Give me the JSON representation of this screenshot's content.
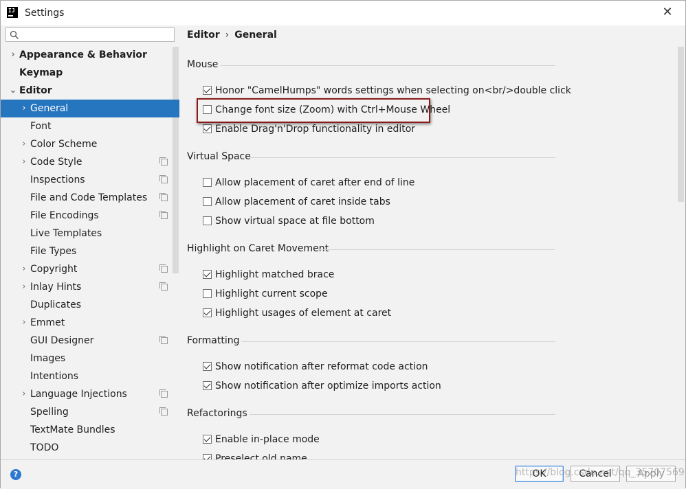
{
  "window": {
    "title": "Settings"
  },
  "search": {
    "placeholder": ""
  },
  "sidebar": {
    "items": [
      {
        "label": "Appearance & Behavior",
        "bold": true,
        "expandable": true
      },
      {
        "label": "Keymap",
        "bold": true
      },
      {
        "label": "Editor",
        "bold": true,
        "expanded": true
      },
      {
        "label": "General",
        "selected": true,
        "expandable": true
      },
      {
        "label": "Font"
      },
      {
        "label": "Color Scheme",
        "expandable": true
      },
      {
        "label": "Code Style",
        "expandable": true,
        "project_icon": true
      },
      {
        "label": "Inspections",
        "project_icon": true
      },
      {
        "label": "File and Code Templates",
        "project_icon": true
      },
      {
        "label": "File Encodings",
        "project_icon": true
      },
      {
        "label": "Live Templates"
      },
      {
        "label": "File Types"
      },
      {
        "label": "Copyright",
        "expandable": true,
        "project_icon": true
      },
      {
        "label": "Inlay Hints",
        "expandable": true,
        "project_icon": true
      },
      {
        "label": "Duplicates"
      },
      {
        "label": "Emmet",
        "expandable": true
      },
      {
        "label": "GUI Designer",
        "project_icon": true
      },
      {
        "label": "Images"
      },
      {
        "label": "Intentions"
      },
      {
        "label": "Language Injections",
        "expandable": true,
        "project_icon": true
      },
      {
        "label": "Spelling",
        "project_icon": true
      },
      {
        "label": "TextMate Bundles"
      },
      {
        "label": "TODO"
      }
    ]
  },
  "breadcrumb": {
    "parent": "Editor",
    "separator": "›",
    "current": "General"
  },
  "sections": {
    "mouse": {
      "title": "Mouse",
      "options": [
        {
          "label": "Honor \"CamelHumps\" words settings when selecting on<br/>double click",
          "checked": true
        },
        {
          "label": "Change font size (Zoom) with Ctrl+Mouse Wheel",
          "checked": false
        },
        {
          "label": "Enable Drag'n'Drop functionality in editor",
          "checked": true
        }
      ]
    },
    "virtual_space": {
      "title": "Virtual Space",
      "options": [
        {
          "label": "Allow placement of caret after end of line",
          "checked": false
        },
        {
          "label": "Allow placement of caret inside tabs",
          "checked": false
        },
        {
          "label": "Show virtual space at file bottom",
          "checked": false
        }
      ]
    },
    "caret_movement": {
      "title": "Highlight on Caret Movement",
      "options": [
        {
          "label": "Highlight matched brace",
          "checked": true
        },
        {
          "label": "Highlight current scope",
          "checked": false
        },
        {
          "label": "Highlight usages of element at caret",
          "checked": true
        }
      ]
    },
    "formatting": {
      "title": "Formatting",
      "options": [
        {
          "label": "Show notification after reformat code action",
          "checked": true
        },
        {
          "label": "Show notification after optimize imports action",
          "checked": true
        }
      ]
    },
    "refactorings": {
      "title": "Refactorings",
      "options": [
        {
          "label": "Enable in-place mode",
          "checked": true
        },
        {
          "label": "Preselect old name",
          "checked": true
        }
      ]
    }
  },
  "footer": {
    "help": "?",
    "ok": "OK",
    "cancel": "Cancel",
    "apply": "Apply"
  },
  "watermark": "https://blog.csdn.net/qq_35707569",
  "colors": {
    "selection": "#2675bf",
    "highlight_border": "#8b1a1a"
  }
}
